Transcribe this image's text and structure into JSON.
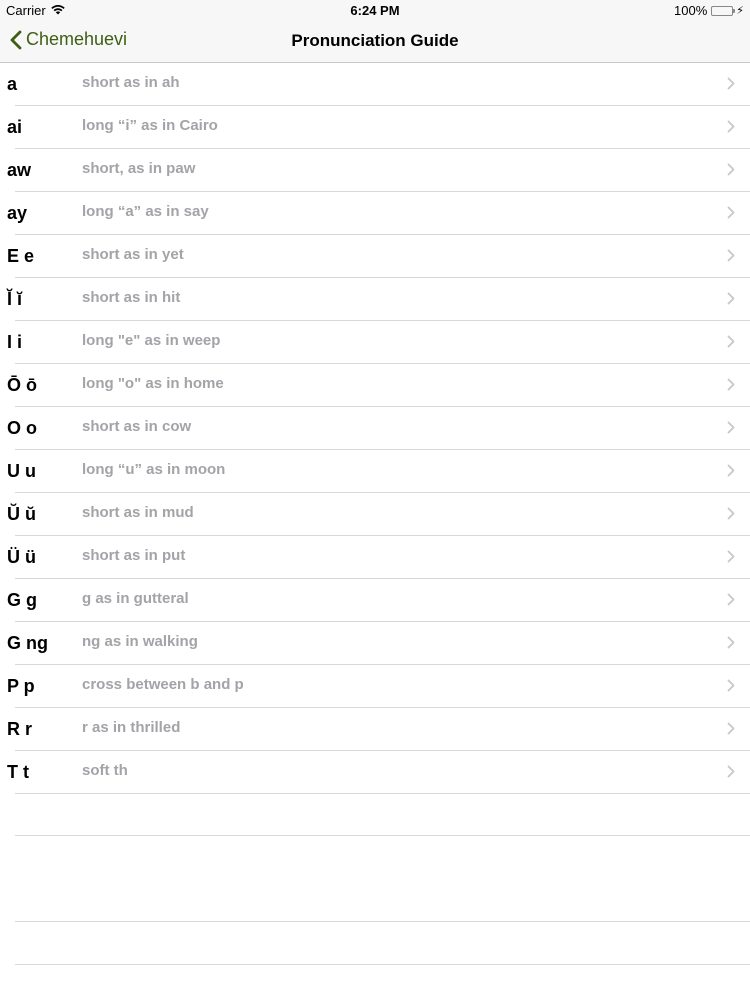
{
  "status_bar": {
    "carrier": "Carrier",
    "time": "6:24 PM",
    "battery": "100%"
  },
  "nav": {
    "back_label": "Chemehuevi",
    "title": "Pronunciation Guide"
  },
  "rows": [
    {
      "letter": "a",
      "desc": "short as in ah"
    },
    {
      "letter": "ai",
      "desc": "long “i” as in Cairo"
    },
    {
      "letter": "aw",
      "desc": "short, as in paw"
    },
    {
      "letter": "ay",
      "desc": "long “a” as in say"
    },
    {
      "letter": "E e",
      "desc": "short as in yet"
    },
    {
      "letter": "Ĭ ĭ",
      "desc": "short as in hit"
    },
    {
      "letter": "I i",
      "desc": "long \"e\" as in weep"
    },
    {
      "letter": "Ō ō",
      "desc": "long \"o\" as in home"
    },
    {
      "letter": "O o",
      "desc": "short as in cow"
    },
    {
      "letter": "U u",
      "desc": "long “u” as in moon"
    },
    {
      "letter": "Ŭ ŭ",
      "desc": "short as in mud"
    },
    {
      "letter": "Ü ü",
      "desc": "short as in put"
    },
    {
      "letter": "G g",
      "desc": "g as in gutteral"
    },
    {
      "letter": "G ng",
      "desc": "ng as in walking"
    },
    {
      "letter": "P p",
      "desc": "cross between b and p"
    },
    {
      "letter": "R r",
      "desc": "r as in thrilled"
    },
    {
      "letter": "T t",
      "desc": "soft th"
    }
  ],
  "colors": {
    "accent": "#3c5f13",
    "secondary_text": "#a3a3a8",
    "battery": "#4cd964"
  }
}
